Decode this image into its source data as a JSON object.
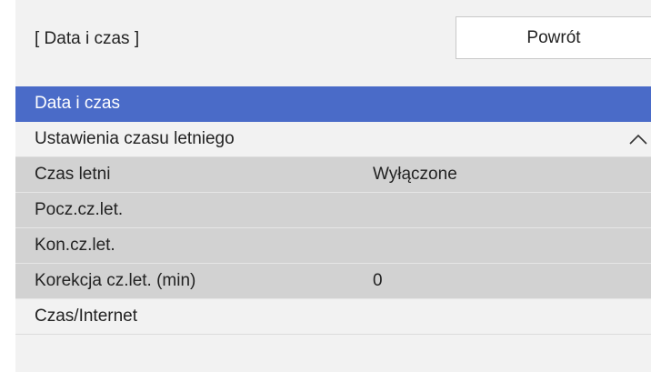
{
  "header": {
    "title": "[ Data i czas ]",
    "back_label": "Powrót"
  },
  "menu": {
    "items": [
      {
        "label": "Data i czas",
        "value": ""
      },
      {
        "label": "Ustawienia czasu letniego",
        "value": "",
        "icon": "chevron-up-icon"
      },
      {
        "label": "Czas letni",
        "value": "Wyłączone"
      },
      {
        "label": "Pocz.cz.let.",
        "value": ""
      },
      {
        "label": "Kon.cz.let.",
        "value": ""
      },
      {
        "label": "Korekcja cz.let. (min)",
        "value": "0"
      },
      {
        "label": "Czas/Internet",
        "value": ""
      }
    ]
  },
  "colors": {
    "selection": "#4a6bc8",
    "submenu_background": "#d2d2d2",
    "panel_background": "#f2f2f2"
  }
}
